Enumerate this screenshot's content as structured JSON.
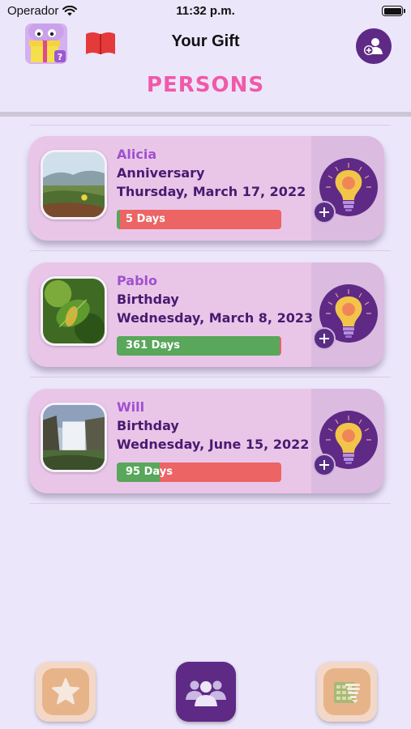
{
  "status_bar": {
    "carrier": "Operador",
    "time": "11:32 p.m."
  },
  "header": {
    "title": "Your Gift",
    "section_title": "PERSONS"
  },
  "persons": [
    {
      "name": "Alicia",
      "event": "Anniversary",
      "date": "Thursday, March 17, 2022",
      "days_label": "5 Days",
      "progress": 0.02,
      "photo": "coastal-landscape-photo"
    },
    {
      "name": "Pablo",
      "event": "Birthday",
      "date": "Wednesday, March 8, 2023",
      "days_label": "361 Days",
      "progress": 0.99,
      "photo": "leaf-closeup-photo"
    },
    {
      "name": "Will",
      "event": "Birthday",
      "date": "Wednesday, June 15, 2022",
      "days_label": "95 Days",
      "progress": 0.26,
      "photo": "waterfall-photo"
    }
  ],
  "tab_bar": {
    "tabs": [
      {
        "icon": "star-icon",
        "selected": false
      },
      {
        "icon": "people-icon",
        "selected": true
      },
      {
        "icon": "calendar-list-icon",
        "selected": false
      }
    ]
  },
  "colors": {
    "background": "#ece6fb",
    "card": "#e9c6e8",
    "accent_purple": "#5e2a86",
    "title_pink": "#ef5aa9",
    "name_purple": "#a050d0",
    "text_dark_purple": "#4a1a70",
    "bar_red": "#ec6464",
    "bar_green": "#58a75a",
    "book_red": "#e53a3a"
  }
}
